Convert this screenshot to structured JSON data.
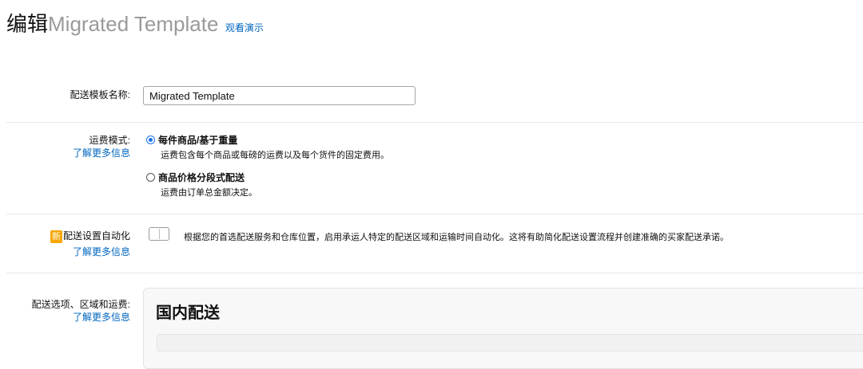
{
  "header": {
    "prefix": "编辑",
    "template_name": "Migrated Template",
    "demo_link": "观看演示"
  },
  "template_name_field": {
    "label": "配送模板名称:",
    "value": "Migrated Template"
  },
  "shipping_mode": {
    "label": "运费模式:",
    "learn_more": "了解更多信息",
    "options": [
      {
        "title": "每件商品/基于重量",
        "description": "运费包含每个商品或每磅的运费以及每个货件的固定费用。",
        "selected": true
      },
      {
        "title": "商品价格分段式配送",
        "description": "运费由订单总金额决定。",
        "selected": false
      }
    ]
  },
  "automation": {
    "badge": "新",
    "label": "配送设置自动化",
    "learn_more": "了解更多信息",
    "enabled": false,
    "description": "根据您的首选配送服务和仓库位置，启用承运人特定的配送区域和运输时间自动化。这将有助简化配送设置流程并创建准确的买家配送承诺。"
  },
  "shipping_options": {
    "label": "配送选项、区域和运费:",
    "learn_more": "了解更多信息",
    "section_title": "国内配送"
  },
  "colors": {
    "link": "#0066c0",
    "badge": "#f7a600",
    "radio_selected": "#1a73e8"
  }
}
